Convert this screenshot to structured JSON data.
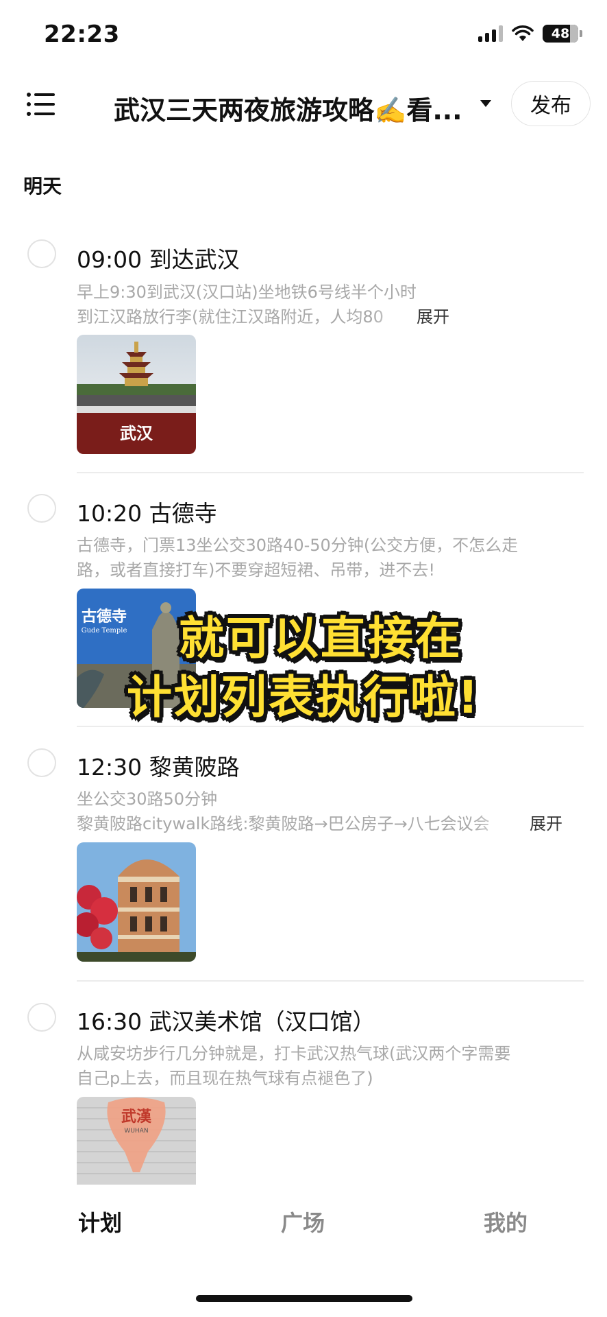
{
  "status_bar": {
    "time": "22:23",
    "battery": "48"
  },
  "header": {
    "title": "武汉三天两夜旅游攻略✍️看...",
    "publish_label": "发布"
  },
  "day_label": "明天",
  "items": [
    {
      "title": "09:00 到达武汉",
      "desc_lines": [
        "早上9:30到武汉(汉口站)坐地铁6号线半个小时",
        "到江汉路放行李(就住江汉路附近，人均80"
      ],
      "expand_label": "展开",
      "thumb_text": "武汉"
    },
    {
      "title": "10:20 古德寺",
      "desc_lines": [
        "古德寺，门票13坐公交30路40-50分钟(公交方便，不怎么走",
        "路，或者直接打车)不要穿超短裙、吊带，进不去!"
      ],
      "thumb_text": "古德寺",
      "thumb_subtext": "Gude Temple"
    },
    {
      "title": "12:30 黎黄陂路",
      "desc_lines": [
        "坐公交30路50分钟",
        "黎黄陂路citywalk路线:黎黄陂路→巴公房子→八七会议会"
      ],
      "expand_label": "展开"
    },
    {
      "title": "16:30 武汉美术馆（汉口馆）",
      "desc_lines": [
        "从咸安坊步行几分钟就是，打卡武汉热气球(武汉两个字需要",
        "自己p上去，而且现在热气球有点褪色了)"
      ],
      "thumb_text": "武漢",
      "thumb_subtext": "WUHAN"
    }
  ],
  "overlay": {
    "line1": "就可以直接在",
    "line2": "计划列表执行啦!"
  },
  "tabs": [
    {
      "label": "计划",
      "active": true
    },
    {
      "label": "广场",
      "active": false
    },
    {
      "label": "我的",
      "active": false
    }
  ]
}
